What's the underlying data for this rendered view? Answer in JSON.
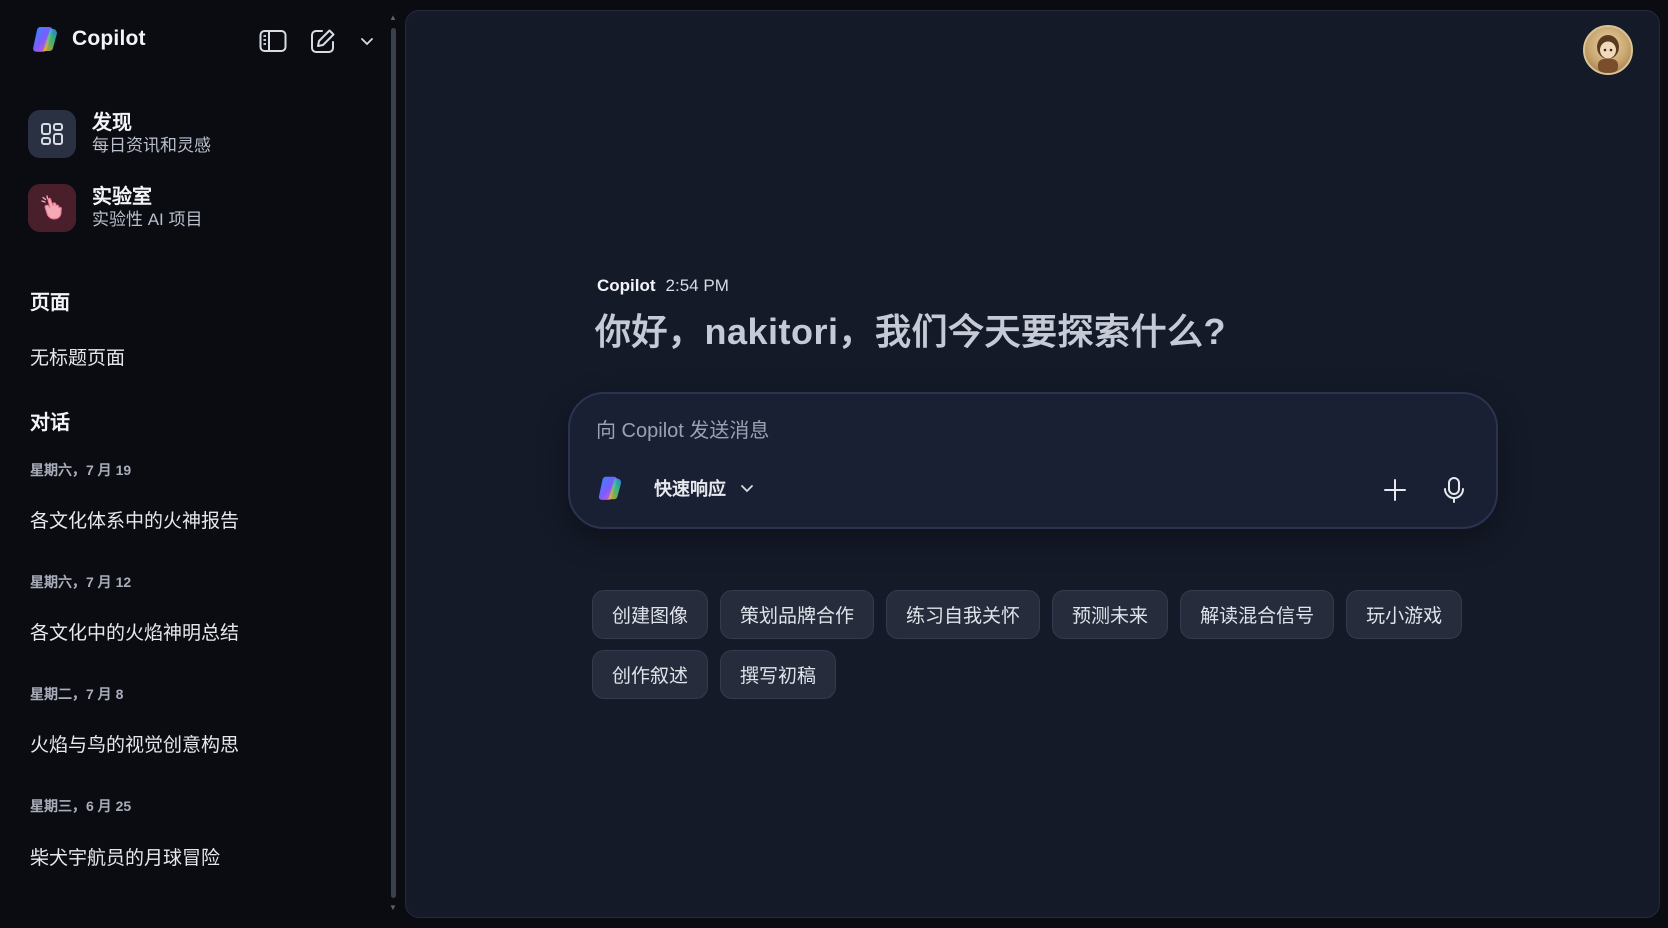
{
  "app": {
    "name": "Copilot"
  },
  "sidebar": {
    "features": [
      {
        "title": "发现",
        "subtitle": "每日资讯和灵感",
        "icon": "grid-icon"
      },
      {
        "title": "实验室",
        "subtitle": "实验性 AI 项目",
        "icon": "hand-pointer-icon"
      }
    ],
    "pages_heading": "页面",
    "pages": [
      "无标题页面"
    ],
    "conversations_heading": "对话",
    "conversations": [
      {
        "date": "星期六，7 月 19",
        "title": "各文化体系中的火神报告"
      },
      {
        "date": "星期六，7 月 12",
        "title": "各文化中的火焰神明总结"
      },
      {
        "date": "星期二，7 月 8",
        "title": "火焰与鸟的视觉创意构思"
      },
      {
        "date": "星期三，6 月 25",
        "title": "柴犬宇航员的月球冒险"
      }
    ]
  },
  "chat": {
    "sender": "Copilot",
    "time": "2:54 PM",
    "greeting": "你好，nakitori，我们今天要探索什么?"
  },
  "composer": {
    "placeholder": "向 Copilot 发送消息",
    "mode": "快速响应"
  },
  "suggestions": [
    "创建图像",
    "策划品牌合作",
    "练习自我关怀",
    "预测未来",
    "解读混合信号",
    "玩小游戏",
    "创作叙述",
    "撰写初稿"
  ],
  "colors": {
    "sidebar_bg": "#0a0c12",
    "main_bg": "#141a28",
    "composer_bg": "#1a2033",
    "chip_bg": "#262c3c",
    "labs_tile": "#4a1f2c",
    "discover_tile": "#2a3142"
  }
}
